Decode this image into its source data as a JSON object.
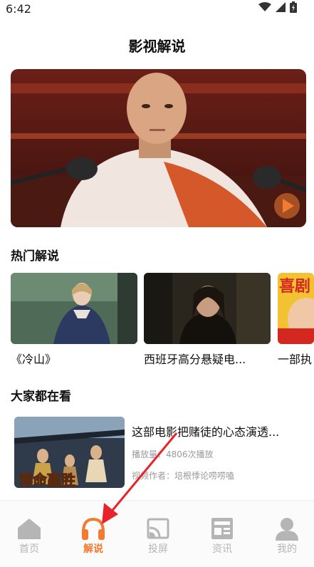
{
  "status_bar": {
    "time": "6:42"
  },
  "header": {
    "title": "影视解说"
  },
  "sections": {
    "hot_title": "热门解说",
    "feed_title": "大家都在看"
  },
  "hot_items": [
    {
      "label": "《冷山》"
    },
    {
      "label": "西班牙高分悬疑电..."
    },
    {
      "label": "一部执",
      "poster_text": "喜剧"
    }
  ],
  "feed_items": [
    {
      "title": "这部电影把赌徒的心态演透...",
      "plays": "播放量：4806次播放",
      "author": "视频作者：培根悸论唠唠嗑",
      "poster_text": "博命赢胜"
    }
  ],
  "tabs": [
    {
      "label": "首页",
      "icon": "home-icon",
      "active": false
    },
    {
      "label": "解说",
      "icon": "headphones-icon",
      "active": true
    },
    {
      "label": "投屏",
      "icon": "cast-icon",
      "active": false
    },
    {
      "label": "资讯",
      "icon": "news-icon",
      "active": false
    },
    {
      "label": "我的",
      "icon": "profile-icon",
      "active": false
    }
  ],
  "colors": {
    "accent": "#f37b2f",
    "inactive": "#b5b5b5",
    "annotation_arrow": "#e8232a"
  }
}
